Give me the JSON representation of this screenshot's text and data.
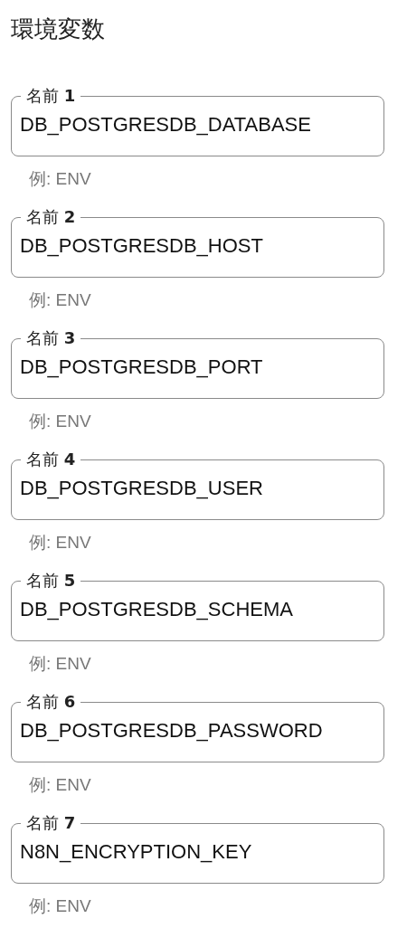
{
  "title": "環境変数",
  "fields": [
    {
      "label": "名前 **1**",
      "value": "DB_POSTGRESDB_DATABASE",
      "helper": "例: ENV"
    },
    {
      "label": "名前 **2**",
      "value": "DB_POSTGRESDB_HOST",
      "helper": "例: ENV"
    },
    {
      "label": "名前 **3**",
      "value": "DB_POSTGRESDB_PORT",
      "helper": "例: ENV"
    },
    {
      "label": "名前 **4**",
      "value": "DB_POSTGRESDB_USER",
      "helper": "例: ENV"
    },
    {
      "label": "名前 **5**",
      "value": "DB_POSTGRESDB_SCHEMA",
      "helper": "例: ENV"
    },
    {
      "label": "名前 **6**",
      "value": "DB_POSTGRESDB_PASSWORD",
      "helper": "例: ENV"
    },
    {
      "label": "名前 **7**",
      "value": "N8N_ENCRYPTION_KEY",
      "helper": "例: ENV"
    }
  ]
}
